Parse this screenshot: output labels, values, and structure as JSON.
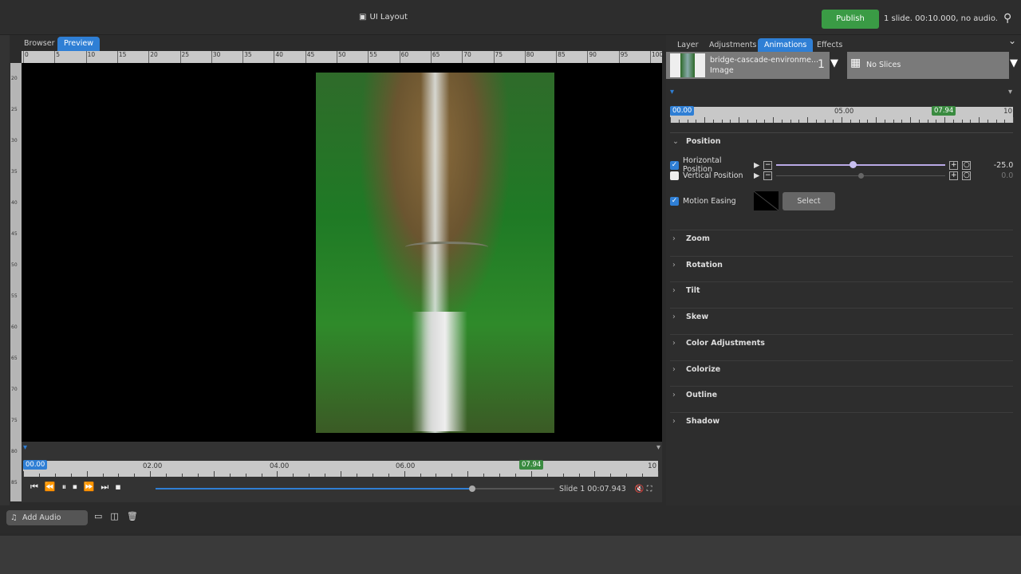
{
  "topbar": {
    "layout_label": "UI Layout",
    "publish_label": "Publish",
    "status": "1 slide. 00:10.000, no audio."
  },
  "left_tabs": [
    {
      "label": "Browser"
    },
    {
      "label": "Preview"
    }
  ],
  "ruler_top": [
    "0",
    "5",
    "10",
    "15",
    "20",
    "25",
    "30",
    "35",
    "40",
    "45",
    "50",
    "55",
    "60",
    "65",
    "70",
    "75",
    "80",
    "85",
    "90",
    "95",
    "100"
  ],
  "ruler_left": [
    "20",
    "25",
    "30",
    "35",
    "40",
    "45",
    "50",
    "55",
    "60",
    "65",
    "70",
    "75",
    "80",
    "85"
  ],
  "timeline": {
    "start": "00.00",
    "labels": [
      "02.00",
      "04.00",
      "06.00"
    ],
    "end": "10",
    "current": "07.94",
    "progress_fraction": 0.794
  },
  "playback": {
    "slide": "Slide 1",
    "time": "00:07.943"
  },
  "bottom": {
    "add_audio_label": "Add Audio"
  },
  "right_tabs": [
    {
      "label": "Layer"
    },
    {
      "label": "Adjustments"
    },
    {
      "label": "Animations"
    },
    {
      "label": "Effects"
    }
  ],
  "layer": {
    "name": "bridge-cascade-environme...",
    "type": "Image",
    "count": "1"
  },
  "slices": {
    "label": "No Slices"
  },
  "anim_timeline": {
    "start": "00.00",
    "mid": "05.00",
    "end": "10",
    "current": "07.94"
  },
  "position": {
    "title": "Position",
    "horizontal": {
      "label": "Horizontal Position",
      "checked": true,
      "value": "-25.0",
      "fraction": 0.45
    },
    "vertical": {
      "label": "Vertical Position",
      "checked": false,
      "value": "0.0",
      "fraction": 0.5
    },
    "easing": {
      "label": "Motion Easing",
      "checked": true,
      "select_label": "Select"
    }
  },
  "sections": [
    "Zoom",
    "Rotation",
    "Tilt",
    "Skew",
    "Color Adjustments",
    "Colorize",
    "Outline",
    "Shadow"
  ],
  "colors": {
    "accent": "#2f7fd5",
    "publish": "#3a9b45",
    "current_marker": "#3a8b40"
  }
}
